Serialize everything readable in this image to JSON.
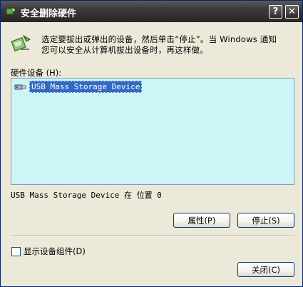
{
  "window": {
    "title": "安全删除硬件",
    "help_button": "?",
    "close_button": "✕"
  },
  "info": {
    "line1": "选定要拔出或弹出的设备，然后单击“停止”。当 Windows  通知",
    "line2": "您可以安全从计算机拔出设备时，再这样做。"
  },
  "hardware": {
    "label": "硬件设备",
    "accel": "(H):",
    "devices": [
      {
        "name": "USB Mass Storage Device",
        "selected": true
      }
    ],
    "location_text": "USB Mass Storage Device 在 位置 0"
  },
  "buttons": {
    "properties": "属性",
    "properties_accel": "(P)",
    "stop": "停止",
    "stop_accel": "(S)",
    "close": "关闭",
    "close_accel": "(C)"
  },
  "show_components": {
    "label": "显示设备组件",
    "accel": "(D)",
    "checked": false
  },
  "colors": {
    "title_bar": "#3a3a3a",
    "list_background": "#ccf5f7",
    "selection": "#316ac5",
    "dialog_face": "#ece9d8"
  }
}
